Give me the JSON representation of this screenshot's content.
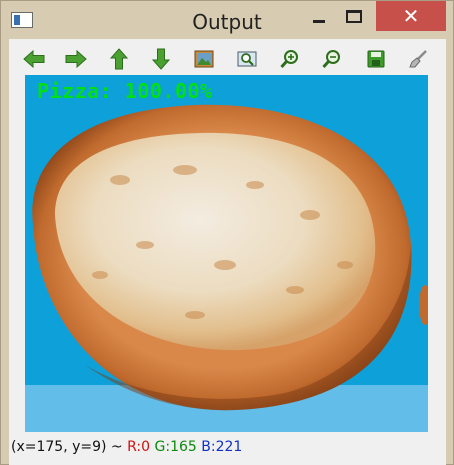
{
  "window": {
    "title": "Output"
  },
  "controls": {
    "close_glyph": "✕"
  },
  "toolbar": {
    "buttons": [
      {
        "name": "pan-left",
        "icon": "arrow-left-icon"
      },
      {
        "name": "pan-right",
        "icon": "arrow-right-icon"
      },
      {
        "name": "pan-up",
        "icon": "arrow-up-icon"
      },
      {
        "name": "pan-down",
        "icon": "arrow-down-icon"
      },
      {
        "name": "zoom-original",
        "icon": "image-icon"
      },
      {
        "name": "zoom-fit",
        "icon": "zoom-fit-icon"
      },
      {
        "name": "zoom-in",
        "icon": "zoom-in-icon"
      },
      {
        "name": "zoom-out",
        "icon": "zoom-out-icon"
      },
      {
        "name": "save",
        "icon": "save-icon"
      },
      {
        "name": "properties",
        "icon": "brush-icon"
      }
    ]
  },
  "image": {
    "overlay_label": "Pizza: 100.00%"
  },
  "status": {
    "coords": "(x=175, y=9) ~ ",
    "r": "R:0",
    "g": "G:165",
    "b": "B:221"
  },
  "colors": {
    "accent_green": "#00e014",
    "close_red": "#c7504b",
    "image_bg": "#0ea0d9"
  }
}
